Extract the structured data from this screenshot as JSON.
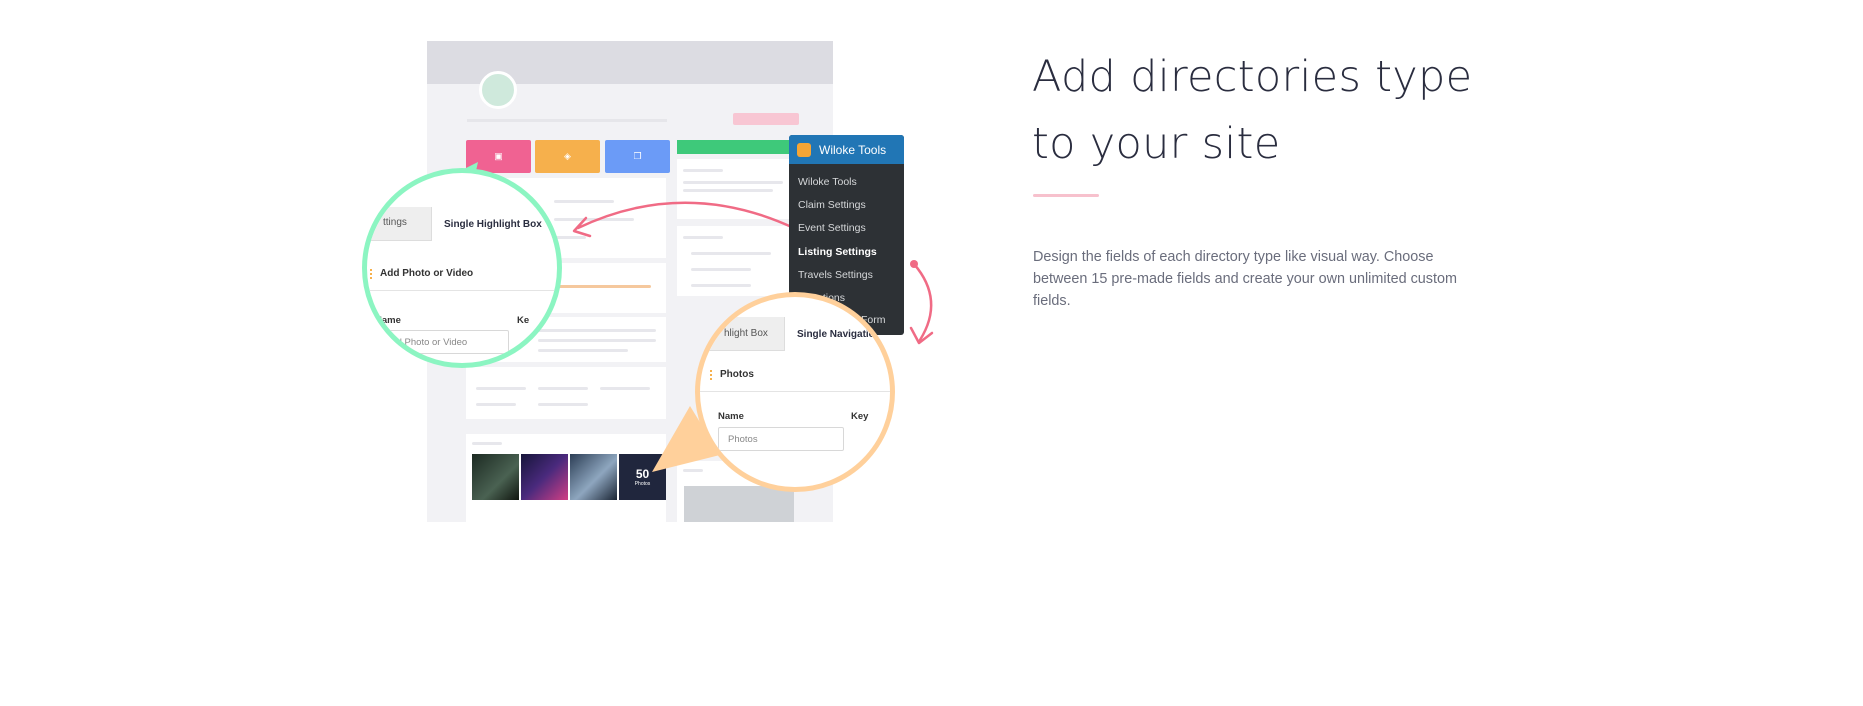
{
  "feature": {
    "title_line1": "Add directories type",
    "title_line2": "to your site",
    "description": "Design the fields of each directory type like visual way. Choose between 15 pre-made fields and create your own unlimited custom fields."
  },
  "wiloke_menu": {
    "title": "Wiloke Tools",
    "items": [
      {
        "label": "Wiloke Tools"
      },
      {
        "label": "Claim Settings"
      },
      {
        "label": "Event Settings"
      },
      {
        "label": "Listing Settings",
        "active": true
      },
      {
        "label": "Travels Settings"
      },
      {
        "label": "ations"
      }
    ],
    "partial_item": "Form"
  },
  "magnifier_left": {
    "tab_partial": "ttings",
    "tab_active": "Single Highlight Box",
    "section": "Add Photo or Video",
    "field_label": "Name",
    "field_label_partial": "Ke",
    "input_placeholder": "Add Photo or Video"
  },
  "magnifier_right": {
    "tab_partial": "hlight Box",
    "tab_active": "Single Navigation",
    "section": "Photos",
    "field_label": "Name",
    "field_label_partial": "Key",
    "input_placeholder": "Photos"
  },
  "mock_listing": {
    "photos_count": "50",
    "photos_label": "Photos"
  },
  "colors": {
    "accent_pink": "#f06292",
    "green": "#8cf5c2",
    "orange": "#ffd09b",
    "menu_blue": "#2176b5",
    "menu_dark": "#2d3135"
  }
}
